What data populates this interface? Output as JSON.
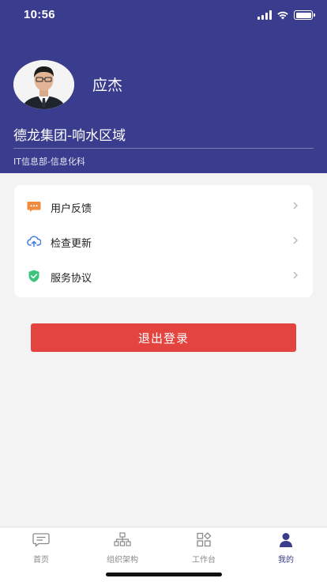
{
  "status_bar": {
    "time": "10:56"
  },
  "profile": {
    "name": "应杰",
    "organization": "德龙集团-响水区域",
    "department": "IT信息部-信息化科"
  },
  "menu": {
    "items": [
      {
        "label": "用户反馈",
        "icon": "feedback-icon"
      },
      {
        "label": "检查更新",
        "icon": "cloud-upload-icon"
      },
      {
        "label": "服务协议",
        "icon": "shield-check-icon"
      }
    ]
  },
  "logout": {
    "label": "退出登录"
  },
  "tabbar": {
    "tabs": [
      {
        "label": "首页",
        "icon": "message-icon",
        "active": false
      },
      {
        "label": "组织架构",
        "icon": "org-chart-icon",
        "active": false
      },
      {
        "label": "工作台",
        "icon": "grid-icon",
        "active": false
      },
      {
        "label": "我的",
        "icon": "person-icon",
        "active": true
      }
    ]
  },
  "colors": {
    "header_bg": "#3a3c8d",
    "logout_bg": "#e3443f",
    "active_tab": "#3a3c8d",
    "feedback_icon": "#f08a3c",
    "update_icon": "#3f7be0",
    "agreement_icon": "#3cc47a"
  }
}
